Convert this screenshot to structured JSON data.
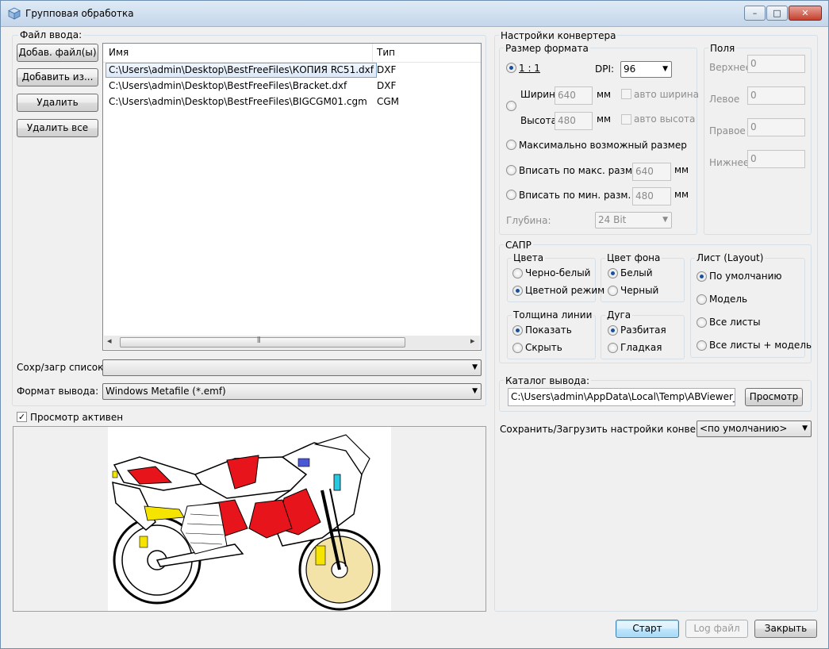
{
  "window": {
    "title": "Групповая обработка",
    "min": "–",
    "max": "□",
    "close": "✕"
  },
  "input": {
    "label": "Файл ввода:",
    "buttons": {
      "add_files": "Добав. файл(ы)",
      "add_from": "Добавить из...",
      "remove": "Удалить",
      "remove_all": "Удалить все"
    },
    "columns": {
      "name": "Имя",
      "type": "Тип"
    },
    "files": [
      {
        "name": "C:\\Users\\admin\\Desktop\\BestFreeFiles\\КОПИЯ RC51.dxf",
        "type": "DXF"
      },
      {
        "name": "C:\\Users\\admin\\Desktop\\BestFreeFiles\\Bracket.dxf",
        "type": "DXF"
      },
      {
        "name": "C:\\Users\\admin\\Desktop\\BestFreeFiles\\BIGCGM01.cgm",
        "type": "CGM"
      }
    ],
    "scroll_left": "◂",
    "scroll_right": "▸",
    "scroll_grip": "⦀"
  },
  "save_load_list": {
    "label": "Сохр/загр список:",
    "value": ""
  },
  "output_format": {
    "label": "Формат вывода:",
    "value": "Windows Metafile (*.emf)"
  },
  "preview": {
    "label": "Просмотр активен",
    "checked": true,
    "check_mark": "✓"
  },
  "converter": {
    "title": "Настройки конвертера",
    "size_format": {
      "title": "Размер формата",
      "one_to_one": "1 : 1",
      "dpi_label": "DPI:",
      "dpi_value": "96",
      "width_label": "Ширина",
      "width_value": "640",
      "height_label": "Высота",
      "height_value": "480",
      "mm": "мм",
      "auto_width": "авто ширина",
      "auto_height": "авто высота",
      "max_size": "Максимально возможный размер",
      "fit_max": "Вписать по макс. разм.",
      "fit_max_value": "640",
      "fit_min": "Вписать по мин. разм.",
      "fit_min_value": "480",
      "depth_label": "Глубина:",
      "depth_value": "24 Bit"
    },
    "margins": {
      "title": "Поля",
      "top_label": "Верхнее",
      "top_value": "0",
      "left_label": "Левое",
      "left_value": "0",
      "right_label": "Правое",
      "right_value": "0",
      "bottom_label": "Нижнее",
      "bottom_value": "0"
    },
    "cad": {
      "title": "САПР",
      "colors": {
        "title": "Цвета",
        "bw": "Черно-белый",
        "color": "Цветной режим"
      },
      "bg_color": {
        "title": "Цвет фона",
        "white": "Белый",
        "black": "Черный"
      },
      "layout": {
        "title": "Лист (Layout)",
        "default": "По умолчанию",
        "model": "Модель",
        "all": "Все листы",
        "all_model": "Все листы + модель"
      },
      "line_weight": {
        "title": "Толщина линии",
        "show": "Показать",
        "hide": "Скрыть"
      },
      "arc": {
        "title": "Дуга",
        "split": "Разбитая",
        "smooth": "Гладкая"
      }
    },
    "output_dir": {
      "title": "Каталог вывода:",
      "value": "C:\\Users\\admin\\AppData\\Local\\Temp\\ABViewer_Bat",
      "browse": "Просмотр"
    },
    "save_settings": {
      "label": "Сохранить/Загрузить настройки конвертера:",
      "value": "<по умолчанию>"
    }
  },
  "footer": {
    "start": "Старт",
    "log": "Log файл",
    "close": "Закрыть"
  },
  "colors": {
    "accent": "#1b4f9c",
    "title_bg": "#dfeaf6",
    "bike_red": "#e8141b",
    "bike_yellow": "#f5e300"
  }
}
